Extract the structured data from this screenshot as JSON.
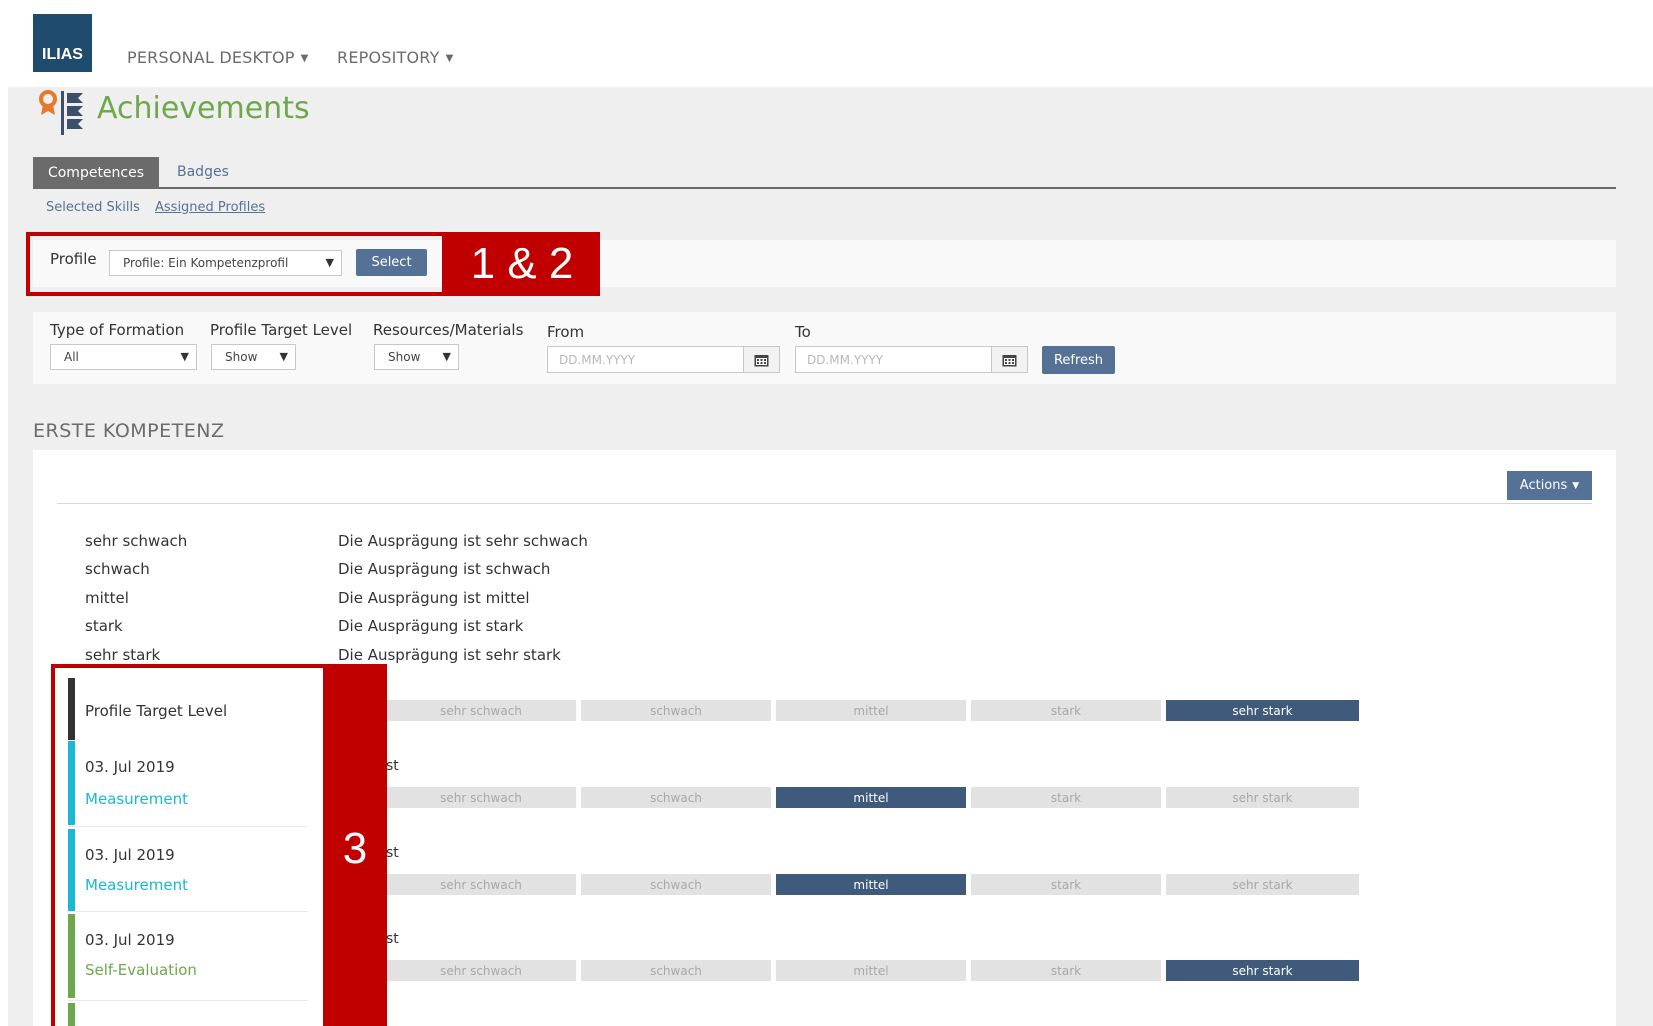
{
  "app": {
    "logo": "ILIAS"
  },
  "nav": [
    {
      "label": "PERSONAL DESKTOP"
    },
    {
      "label": "REPOSITORY"
    }
  ],
  "page": {
    "title": "Achievements"
  },
  "tabs": [
    {
      "label": "Competences",
      "active": true
    },
    {
      "label": "Badges",
      "active": false
    }
  ],
  "subtabs": [
    {
      "label": "Selected Skills"
    },
    {
      "label": "Assigned Profiles"
    }
  ],
  "profile_bar": {
    "label": "Profile",
    "selected": "Profile: Ein Kompetenzprofil",
    "button": "Select"
  },
  "filters": {
    "type_of_formation": {
      "label": "Type of Formation",
      "value": "All"
    },
    "profile_target_level": {
      "label": "Profile Target Level",
      "value": "Show"
    },
    "resources": {
      "label": "Resources/Materials",
      "value": "Show"
    },
    "from": {
      "label": "From",
      "placeholder": "DD.MM.YYYY"
    },
    "to": {
      "label": "To",
      "placeholder": "DD.MM.YYYY"
    },
    "refresh": "Refresh"
  },
  "annotations": {
    "a12": "1 & 2",
    "a3": "3"
  },
  "skill": {
    "title": "ERSTE KOMPETENZ",
    "actions": "Actions",
    "levels": [
      {
        "name": "sehr schwach",
        "desc": "Die Ausprägung ist sehr schwach"
      },
      {
        "name": "schwach",
        "desc": "Die Ausprägung ist schwach"
      },
      {
        "name": "mittel",
        "desc": "Die Ausprägung ist mittel"
      },
      {
        "name": "stark",
        "desc": "Die Ausprägung ist stark"
      },
      {
        "name": "sehr stark",
        "desc": "Die Ausprägung ist sehr stark"
      }
    ],
    "scale": [
      "sehr schwach",
      "schwach",
      "mittel",
      "stark",
      "sehr stark"
    ],
    "rows": [
      {
        "label": "Profile Target Level",
        "type": "",
        "truncated": "",
        "selected_index": 4,
        "bar_color": "#333333"
      },
      {
        "label": "03. Jul 2019",
        "type": "Measurement",
        "truncated": "st",
        "selected_index": 2,
        "bar_color": "#1ab8d4"
      },
      {
        "label": "03. Jul 2019",
        "type": "Measurement",
        "truncated": "st",
        "selected_index": 2,
        "bar_color": "#1ab8d4"
      },
      {
        "label": "03. Jul 2019",
        "type": "Self-Evaluation",
        "truncated": "st",
        "selected_index": 4,
        "bar_color": "#6ea84b"
      }
    ]
  },
  "colors": {
    "accent": "#557196",
    "title_green": "#6ea84b",
    "annotation_red": "#c00000",
    "measurement": "#1ab8d4",
    "self_evaluation": "#6ea84b",
    "level_selected": "#3f5a7a"
  }
}
